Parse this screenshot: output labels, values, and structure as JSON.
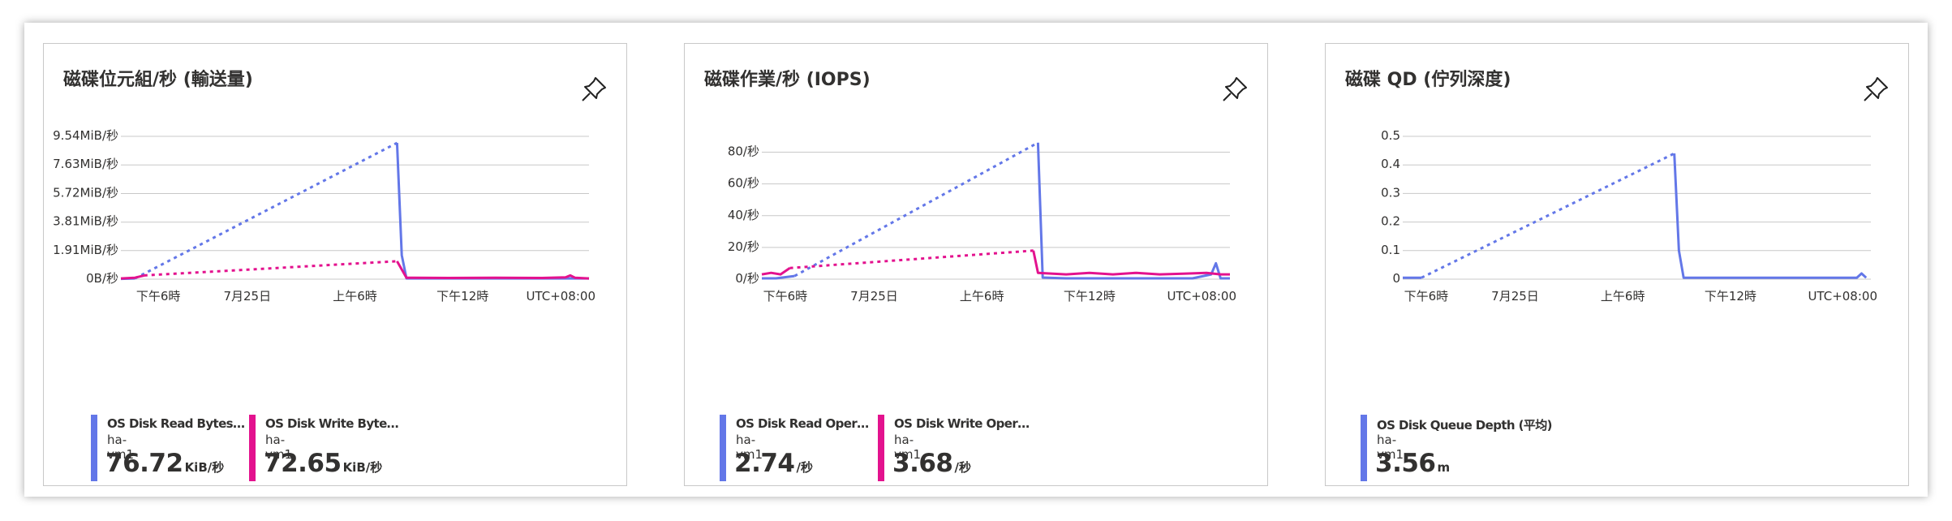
{
  "tiles": [
    {
      "title": "磁碟位元組/秒 (輸送量)",
      "legend": [
        {
          "name": "OS Disk Read Bytes/S...",
          "resource": "ha-vm1",
          "value": "76.72",
          "unit": "KiB/秒",
          "color": "#6377e8"
        },
        {
          "name": "OS Disk Write Bytes/...",
          "resource": "ha-vm1",
          "value": "72.65",
          "unit": "KiB/秒",
          "color": "#e3128e"
        }
      ]
    },
    {
      "title": "磁碟作業/秒 (IOPS)",
      "legend": [
        {
          "name": "OS Disk Read Operati...",
          "resource": "ha-vm1",
          "value": "2.74",
          "unit": "/秒",
          "color": "#6377e8"
        },
        {
          "name": "OS Disk Write Operat...",
          "resource": "ha-vm1",
          "value": "3.68",
          "unit": "/秒",
          "color": "#e3128e"
        }
      ]
    },
    {
      "title": "磁碟 QD (佇列深度)",
      "legend": [
        {
          "name": "OS Disk Queue Depth (平均)",
          "resource": "ha-vm1",
          "value": "3.56",
          "unit": "m",
          "color": "#6377e8"
        }
      ]
    }
  ],
  "chart_data": [
    {
      "type": "line",
      "title": "磁碟位元組/秒 (輸送量)",
      "ylim": [
        0,
        9.54
      ],
      "ytick_values": [
        0,
        1.91,
        3.81,
        5.72,
        7.63,
        9.54
      ],
      "ytick_labels": [
        "0B/秒",
        "1.91MiB/秒",
        "3.81MiB/秒",
        "5.72MiB/秒",
        "7.63MiB/秒",
        "9.54MiB/秒"
      ],
      "xlim": [
        0,
        100
      ],
      "xtick_values": [
        8,
        27,
        50,
        73
      ],
      "xtick_labels": [
        "下午6時",
        "7月25日",
        "上午6時",
        "下午12時"
      ],
      "xtick_suffix": "UTC+08:00",
      "grid": true,
      "series": [
        {
          "name": "OS Disk Read Bytes/S...",
          "color": "#6377e8",
          "segments": [
            {
              "style": "solid",
              "points": [
                [
                  0,
                  0.02
                ],
                [
                  3,
                  0.05
                ]
              ]
            },
            {
              "style": "dotted",
              "points": [
                [
                  3,
                  0.05
                ],
                [
                  59,
                  9.1
                ]
              ]
            },
            {
              "style": "solid",
              "points": [
                [
                  59,
                  9.1
                ],
                [
                  60,
                  1.6
                ],
                [
                  61,
                  0.05
                ],
                [
                  100,
                  0.05
                ]
              ]
            }
          ]
        },
        {
          "name": "OS Disk Write Bytes/...",
          "color": "#e3128e",
          "segments": [
            {
              "style": "solid",
              "points": [
                [
                  0,
                  0.05
                ],
                [
                  3,
                  0.1
                ],
                [
                  5,
                  0.25
                ]
              ]
            },
            {
              "style": "dotted",
              "points": [
                [
                  5,
                  0.25
                ],
                [
                  59,
                  1.2
                ]
              ]
            },
            {
              "style": "solid",
              "points": [
                [
                  59,
                  1.2
                ],
                [
                  61,
                  0.1
                ],
                [
                  70,
                  0.08
                ],
                [
                  80,
                  0.1
                ],
                [
                  90,
                  0.08
                ],
                [
                  95,
                  0.12
                ],
                [
                  96,
                  0.25
                ],
                [
                  97,
                  0.1
                ],
                [
                  100,
                  0.05
                ]
              ]
            }
          ]
        }
      ]
    },
    {
      "type": "line",
      "title": "磁碟作業/秒 (IOPS)",
      "ylim": [
        0,
        90
      ],
      "ytick_values": [
        0,
        20,
        40,
        60,
        80
      ],
      "ytick_labels": [
        "0/秒",
        "20/秒",
        "40/秒",
        "60/秒",
        "80/秒"
      ],
      "xlim": [
        0,
        100
      ],
      "xtick_values": [
        5,
        24,
        47,
        70
      ],
      "xtick_labels": [
        "下午6時",
        "7月25日",
        "上午6時",
        "下午12時"
      ],
      "xtick_suffix": "UTC+08:00",
      "grid": true,
      "series": [
        {
          "name": "OS Disk Read Operati...",
          "color": "#6377e8",
          "segments": [
            {
              "style": "solid",
              "points": [
                [
                  0,
                  0.5
                ],
                [
                  3,
                  0.5
                ],
                [
                  7,
                  2
                ]
              ]
            },
            {
              "style": "dotted",
              "points": [
                [
                  7,
                  2
                ],
                [
                  59,
                  86
                ]
              ]
            },
            {
              "style": "solid",
              "points": [
                [
                  59,
                  86
                ],
                [
                  60,
                  1
                ],
                [
                  65,
                  0.5
                ],
                [
                  80,
                  0.5
                ],
                [
                  92,
                  0.5
                ],
                [
                  96,
                  3
                ],
                [
                  97,
                  10
                ],
                [
                  98,
                  0.5
                ],
                [
                  100,
                  0.5
                ]
              ]
            }
          ]
        },
        {
          "name": "OS Disk Write Operat...",
          "color": "#e3128e",
          "segments": [
            {
              "style": "solid",
              "points": [
                [
                  0,
                  3
                ],
                [
                  2,
                  4
                ],
                [
                  4,
                  3
                ],
                [
                  6,
                  7
                ]
              ]
            },
            {
              "style": "dotted",
              "points": [
                [
                  6,
                  7
                ],
                [
                  58,
                  18
                ]
              ]
            },
            {
              "style": "solid",
              "points": [
                [
                  58,
                  18
                ],
                [
                  59,
                  4
                ],
                [
                  65,
                  3
                ],
                [
                  70,
                  4
                ],
                [
                  75,
                  3
                ],
                [
                  80,
                  4
                ],
                [
                  85,
                  3
                ],
                [
                  90,
                  3.5
                ],
                [
                  95,
                  4
                ],
                [
                  98,
                  3
                ],
                [
                  100,
                  3
                ]
              ]
            }
          ]
        }
      ]
    },
    {
      "type": "line",
      "title": "磁碟 QD (佇列深度)",
      "ylim": [
        0,
        0.5
      ],
      "ytick_values": [
        0,
        0.1,
        0.2,
        0.3,
        0.4,
        0.5
      ],
      "ytick_labels": [
        "0",
        "0.1",
        "0.2",
        "0.3",
        "0.4",
        "0.5"
      ],
      "xlim": [
        0,
        100
      ],
      "xtick_values": [
        5,
        24,
        47,
        70
      ],
      "xtick_labels": [
        "下午6時",
        "7月25日",
        "上午6時",
        "下午12時"
      ],
      "xtick_suffix": "UTC+08:00",
      "grid": true,
      "series": [
        {
          "name": "OS Disk Queue Depth (平均)",
          "color": "#6377e8",
          "segments": [
            {
              "style": "solid",
              "points": [
                [
                  0,
                  0.005
                ],
                [
                  4,
                  0.005
                ]
              ]
            },
            {
              "style": "dotted",
              "points": [
                [
                  4,
                  0.005
                ],
                [
                  58,
                  0.44
                ]
              ]
            },
            {
              "style": "solid",
              "points": [
                [
                  58,
                  0.44
                ],
                [
                  59,
                  0.1
                ],
                [
                  60,
                  0.005
                ],
                [
                  97,
                  0.005
                ],
                [
                  98,
                  0.02
                ],
                [
                  99,
                  0.005
                ]
              ]
            }
          ]
        }
      ]
    }
  ]
}
